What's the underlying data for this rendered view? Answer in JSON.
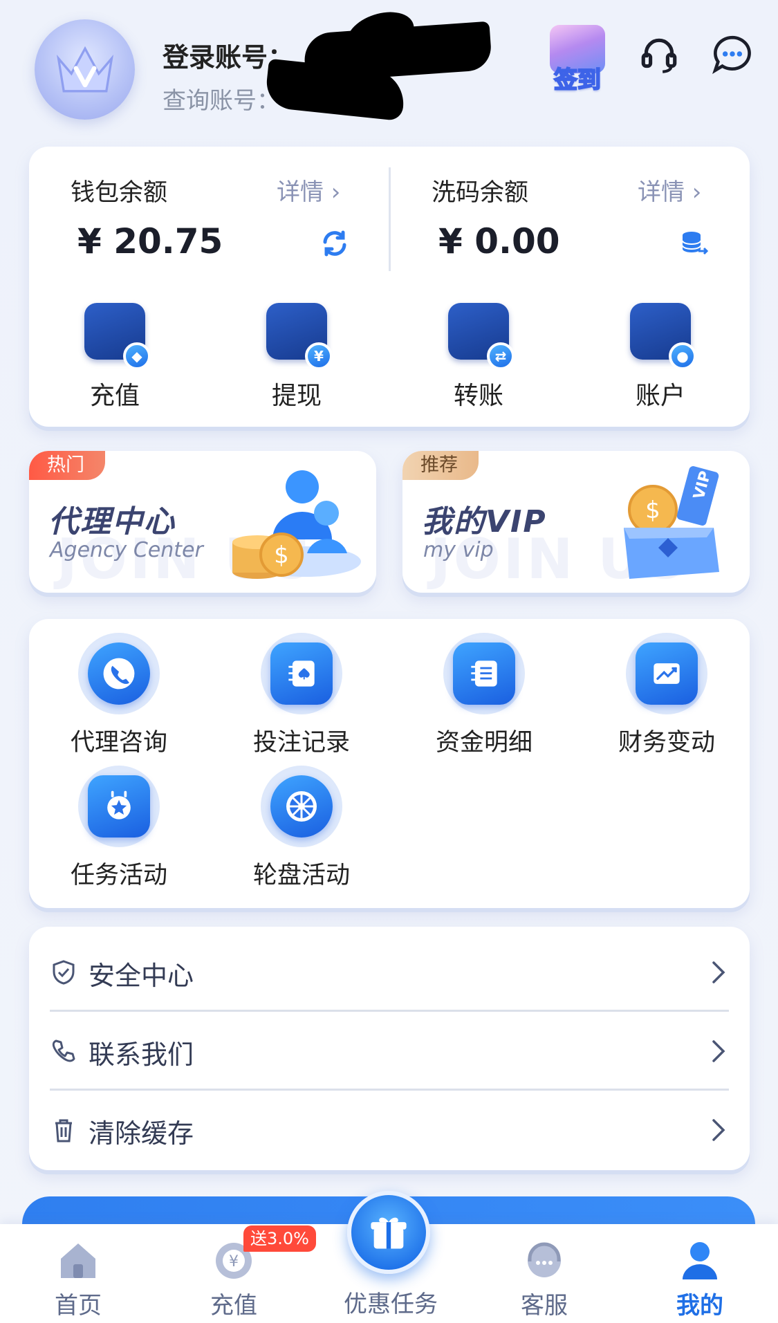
{
  "header": {
    "login_label": "登录账号：",
    "query_label": "查询账号：",
    "checkin_label": "签到",
    "icons": [
      "headset-icon",
      "chat-icon"
    ]
  },
  "wallet": {
    "left": {
      "title": "钱包余额",
      "detail": "详情 ›",
      "amount": "¥ 20.75",
      "icon": "refresh-icon"
    },
    "right": {
      "title": "洗码余额",
      "detail": "详情 ›",
      "amount": "¥ 0.00",
      "icon": "database-icon"
    },
    "actions": [
      {
        "label": "充值",
        "icon": "wallet-icon",
        "badge": "◆"
      },
      {
        "label": "提现",
        "icon": "card-icon",
        "badge": "¥"
      },
      {
        "label": "转账",
        "icon": "transfer-icon",
        "badge": "⇄"
      },
      {
        "label": "账户",
        "icon": "account-icon",
        "badge": "●"
      }
    ]
  },
  "promos": [
    {
      "tag": "热门",
      "title": "代理中心",
      "subtitle": "Agency Center",
      "ghost": "JOIN US",
      "tag_color": "#f0664a"
    },
    {
      "tag": "推荐",
      "title": "我的VIP",
      "subtitle": "my vip",
      "ghost": "JOIN US",
      "tag_color": "#e9b98a"
    }
  ],
  "services": [
    {
      "label": "代理咨询",
      "icon": "phone-icon"
    },
    {
      "label": "投注记录",
      "icon": "notebook-icon"
    },
    {
      "label": "资金明细",
      "icon": "ledger-icon"
    },
    {
      "label": "财务变动",
      "icon": "chart-icon"
    },
    {
      "label": "任务活动",
      "icon": "calendar-star-icon"
    },
    {
      "label": "轮盘活动",
      "icon": "wheel-icon"
    }
  ],
  "menu": [
    {
      "label": "安全中心",
      "icon": "shield-icon"
    },
    {
      "label": "联系我们",
      "icon": "phone-outline-icon"
    },
    {
      "label": "清除缓存",
      "icon": "trash-icon"
    }
  ],
  "tabbar": {
    "tabs": [
      {
        "label": "首页",
        "icon": "home-icon",
        "active": false
      },
      {
        "label": "充值",
        "icon": "deposit-icon",
        "active": false
      },
      {
        "label": "优惠任务",
        "icon": "gift-icon",
        "active": false
      },
      {
        "label": "客服",
        "icon": "support-icon",
        "active": false
      },
      {
        "label": "我的",
        "icon": "user-icon",
        "active": true
      }
    ],
    "deposit_badge": "送3.0%"
  },
  "colors": {
    "accent": "#1f6fe6",
    "hot_tag": "#f0664a",
    "badge_red": "#ff4a3a"
  }
}
